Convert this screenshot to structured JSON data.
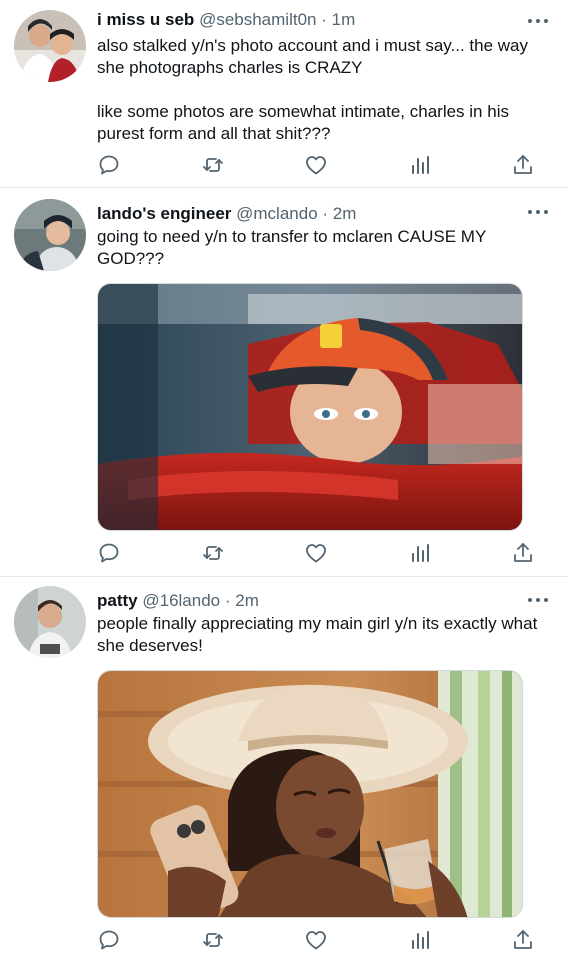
{
  "tweets": [
    {
      "name": "i miss u seb",
      "handle": "@sebshamilt0n",
      "dot": "·",
      "time": "1m",
      "text": "also stalked y/n's photo account and i must say... the way she photographs charles is CRAZY\n\nlike some photos are somewhat intimate, charles in his purest form and all that shit???",
      "avatar_icon": "user-avatar",
      "has_media": false
    },
    {
      "name": "lando's engineer",
      "handle": "@mclando",
      "dot": "·",
      "time": "2m",
      "text": "going to need y/n to transfer to mclaren CAUSE MY GOD???",
      "avatar_icon": "user-avatar",
      "has_media": true,
      "media_icon": "photo-driver-in-cockpit"
    },
    {
      "name": "patty",
      "handle": "@16lando",
      "dot": "·",
      "time": "2m",
      "text": "people finally appreciating my main girl y/n its exactly what she deserves!",
      "avatar_icon": "user-avatar",
      "has_media": true,
      "media_icon": "photo-woman-in-sun-hat"
    }
  ],
  "actions": [
    "reply-icon",
    "retweet-icon",
    "like-icon",
    "analytics-icon",
    "share-icon"
  ],
  "colors": {
    "text_primary": "#0f1419",
    "text_secondary": "#536471",
    "divider": "#e6e8ea",
    "icon": "#536471"
  }
}
